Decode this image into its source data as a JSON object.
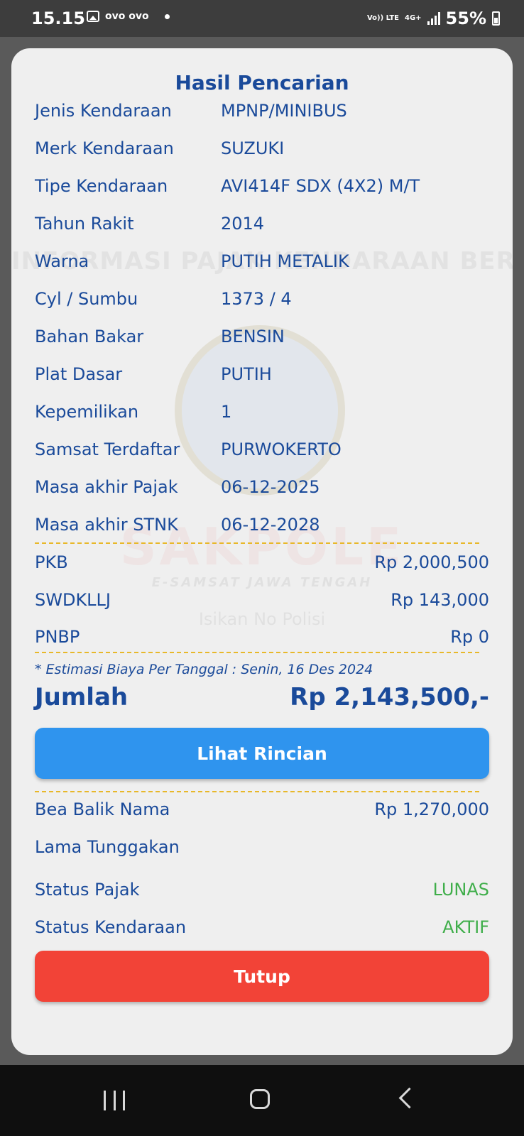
{
  "status_bar": {
    "time": "15.15",
    "left_text": "ovo ovo",
    "lte_label": "Vo)) LTE",
    "net_label": "4G+",
    "battery": "55%"
  },
  "watermark": {
    "text": "INFORMASI PAJAK KENDARAAN BERMOTOR",
    "brand": "SAKPOLE",
    "sub": "E-SAMSAT JAWA TENGAH",
    "hint": "Isikan No Polisi"
  },
  "modal": {
    "title": "Hasil Pencarian",
    "vehicle": [
      {
        "label": "Jenis Kendaraan",
        "value": "MPNP/MINIBUS"
      },
      {
        "label": "Merk Kendaraan",
        "value": "SUZUKI"
      },
      {
        "label": "Tipe Kendaraan",
        "value": "AVI414F SDX (4X2) M/T"
      },
      {
        "label": "Tahun Rakit",
        "value": "2014"
      },
      {
        "label": "Warna",
        "value": "PUTIH METALIK"
      },
      {
        "label": "Cyl / Sumbu",
        "value": "1373 / 4"
      },
      {
        "label": "Bahan Bakar",
        "value": "BENSIN"
      },
      {
        "label": "Plat Dasar",
        "value": "PUTIH"
      },
      {
        "label": "Kepemilikan",
        "value": "1"
      },
      {
        "label": "Samsat Terdaftar",
        "value": "PURWOKERTO"
      },
      {
        "label": "Masa akhir Pajak",
        "value": "06-12-2025"
      },
      {
        "label": "Masa akhir STNK",
        "value": "06-12-2028"
      }
    ],
    "fees": [
      {
        "label": "PKB",
        "value": "Rp 2,000,500"
      },
      {
        "label": "SWDKLLJ",
        "value": "Rp 143,000"
      },
      {
        "label": "PNBP",
        "value": "Rp 0"
      }
    ],
    "estimate_note": "* Estimasi Biaya Per Tanggal : Senin, 16 Des 2024",
    "total_label": "Jumlah",
    "total_value": "Rp 2,143,500,-",
    "detail_button": "Lihat Rincian",
    "extra": [
      {
        "label": "Bea Balik Nama",
        "value": "Rp 1,270,000"
      },
      {
        "label": "Lama Tunggakan",
        "value": ""
      },
      {
        "label": "Status Pajak",
        "value": "LUNAS"
      },
      {
        "label": "Status Kendaraan",
        "value": "AKTIF"
      }
    ],
    "close_button": "Tutup",
    "status_color": "#3fae4a",
    "accent_color": "#1a4a9a"
  },
  "nav_bar": {
    "icons": [
      "recents-icon",
      "home-icon",
      "back-icon"
    ]
  }
}
